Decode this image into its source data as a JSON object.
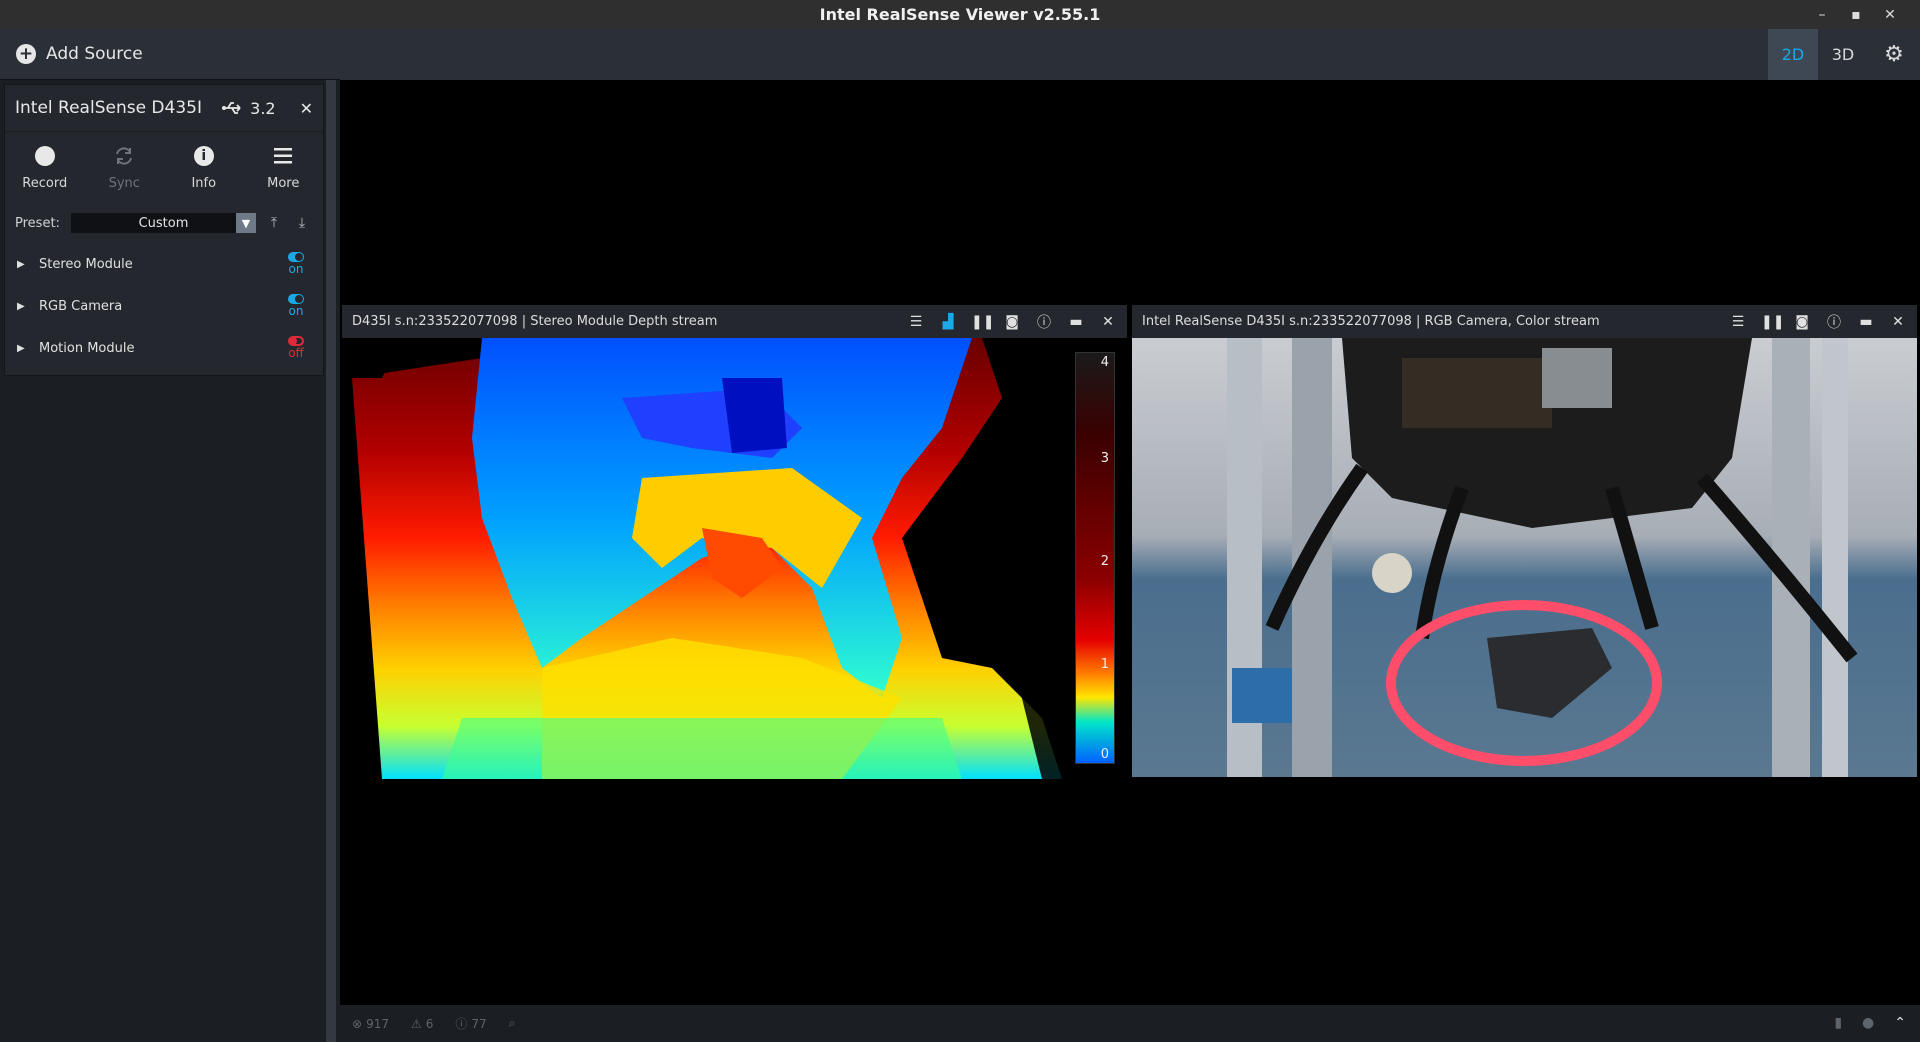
{
  "window": {
    "title": "Intel RealSense Viewer v2.55.1",
    "minimize": "–",
    "maximize": "▪",
    "close": "✕"
  },
  "sidebar": {
    "add_source": "Add Source",
    "device": {
      "name": "Intel RealSense D435I",
      "usb_version": "3.2",
      "actions": [
        {
          "label": "Record",
          "icon": "record-icon"
        },
        {
          "label": "Sync",
          "icon": "sync-icon"
        },
        {
          "label": "Info",
          "icon": "info-icon"
        },
        {
          "label": "More",
          "icon": "menu-icon"
        }
      ],
      "preset_label": "Preset:",
      "preset_value": "Custom",
      "modules": [
        {
          "name": "Stereo Module",
          "state": "on"
        },
        {
          "name": "RGB Camera",
          "state": "on"
        },
        {
          "name": "Motion Module",
          "state": "off"
        }
      ]
    }
  },
  "toolbar": {
    "view_2d": "2D",
    "view_3d": "3D",
    "active_view": "2D"
  },
  "streams": {
    "depth": {
      "title": "D435I s.n:233522077098 | Stereo Module Depth stream",
      "colorbar_ticks": [
        "4",
        "3",
        "2",
        "1",
        "0"
      ]
    },
    "color": {
      "title": "Intel RealSense D435I s.n:233522077098 | RGB Camera, Color stream"
    }
  },
  "status": {
    "errors": "917",
    "warnings": "6",
    "infos": "77"
  },
  "colors": {
    "accent": "#1aa9e6",
    "off_red": "#e02a3a",
    "panel": "#24282e",
    "topbar": "#2b3038"
  }
}
